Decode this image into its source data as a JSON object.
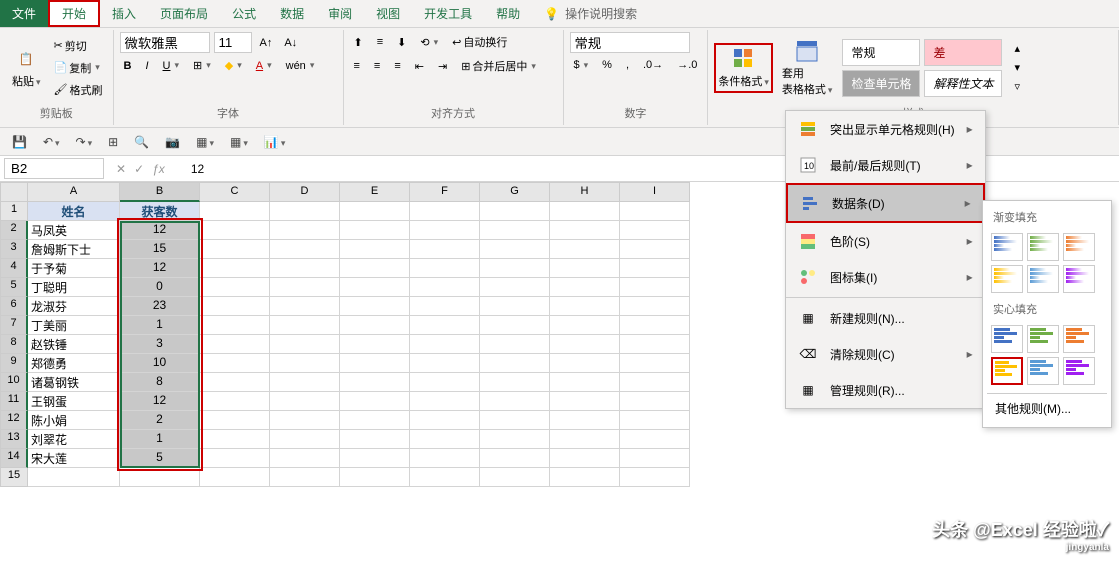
{
  "menu": {
    "file": "文件",
    "home": "开始",
    "insert": "插入",
    "layout": "页面布局",
    "formulas": "公式",
    "data": "数据",
    "review": "审阅",
    "view": "视图",
    "dev": "开发工具",
    "help": "帮助",
    "search": "操作说明搜索"
  },
  "ribbon": {
    "clipboard": {
      "paste": "粘贴",
      "cut": "剪切",
      "copy": "复制",
      "format_painter": "格式刷",
      "label": "剪贴板"
    },
    "font": {
      "name": "微软雅黑",
      "size": "11",
      "label": "字体"
    },
    "align": {
      "wrap": "自动换行",
      "merge": "合并后居中",
      "label": "对齐方式"
    },
    "number": {
      "format": "常规",
      "label": "数字"
    },
    "styles": {
      "cond_format": "条件格式",
      "table_format": "套用\n表格格式",
      "normal": "常规",
      "bad": "差",
      "check": "检查单元格",
      "explain": "解释性文本",
      "label": "样式"
    }
  },
  "qat": {
    "save": "💾"
  },
  "formula_bar": {
    "name_box": "B2",
    "formula": "12"
  },
  "columns": [
    "A",
    "B",
    "C",
    "D",
    "E",
    "F",
    "G",
    "H",
    "I"
  ],
  "col_widths": {
    "A": 92,
    "B": 80,
    "default": 70
  },
  "rows_visible": 15,
  "table": {
    "headers": [
      "姓名",
      "获客数"
    ],
    "rows": [
      [
        "马凤英",
        "12"
      ],
      [
        "詹姆斯下士",
        "15"
      ],
      [
        "于予菊",
        "12"
      ],
      [
        "丁聪明",
        "0"
      ],
      [
        "龙淑芬",
        "23"
      ],
      [
        "丁美丽",
        "1"
      ],
      [
        "赵铁锤",
        "3"
      ],
      [
        "郑德勇",
        "10"
      ],
      [
        "诸葛钢铁",
        "8"
      ],
      [
        "王钢蛋",
        "12"
      ],
      [
        "陈小娟",
        "2"
      ],
      [
        "刘翠花",
        "1"
      ],
      [
        "宋大莲",
        "5"
      ]
    ]
  },
  "dropdown": {
    "highlight": "突出显示单元格规则(H)",
    "top_bottom": "最前/最后规则(T)",
    "data_bars": "数据条(D)",
    "color_scales": "色阶(S)",
    "icon_sets": "图标集(I)",
    "new_rule": "新建规则(N)...",
    "clear_rules": "清除规则(C)",
    "manage_rules": "管理规则(R)..."
  },
  "submenu": {
    "gradient": "渐变填充",
    "solid": "实心填充",
    "more_rules": "其他规则(M)..."
  },
  "watermark": {
    "main": "头条 @Excel 经验啦",
    "sub": "jingyanla"
  },
  "chart_data": {
    "type": "table",
    "title": "",
    "columns": [
      "姓名",
      "获客数"
    ],
    "rows": [
      {
        "姓名": "马凤英",
        "获客数": 12
      },
      {
        "姓名": "詹姆斯下士",
        "获客数": 15
      },
      {
        "姓名": "于予菊",
        "获客数": 12
      },
      {
        "姓名": "丁聪明",
        "获客数": 0
      },
      {
        "姓名": "龙淑芬",
        "获客数": 23
      },
      {
        "姓名": "丁美丽",
        "获客数": 1
      },
      {
        "姓名": "赵铁锤",
        "获客数": 3
      },
      {
        "姓名": "郑德勇",
        "获客数": 10
      },
      {
        "姓名": "诸葛钢铁",
        "获客数": 8
      },
      {
        "姓名": "王钢蛋",
        "获客数": 12
      },
      {
        "姓名": "陈小娟",
        "获客数": 2
      },
      {
        "姓名": "刘翠花",
        "获客数": 1
      },
      {
        "姓名": "宋大莲",
        "获客数": 5
      }
    ]
  }
}
